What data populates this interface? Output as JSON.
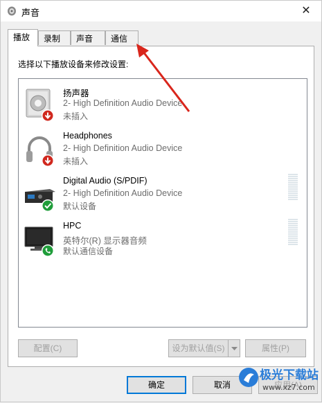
{
  "window": {
    "title": "声音",
    "close_glyph": "✕"
  },
  "tabs": [
    {
      "label": "播放",
      "active": true
    },
    {
      "label": "录制",
      "active": false
    },
    {
      "label": "声音",
      "active": false
    },
    {
      "label": "通信",
      "active": false
    }
  ],
  "instruction": "选择以下播放设备来修改设置:",
  "devices": [
    {
      "name": "扬声器",
      "line2": "2- High Definition Audio Device",
      "line3": "未插入",
      "icon": "speaker-icon",
      "status": "unplugged"
    },
    {
      "name": "Headphones",
      "line2": "2- High Definition Audio Device",
      "line3": "未插入",
      "icon": "headphones-icon",
      "status": "unplugged"
    },
    {
      "name": "Digital Audio (S/PDIF)",
      "line2": "2- High Definition Audio Device",
      "line3": "默认设备",
      "icon": "spdif-receiver-icon",
      "status": "default"
    },
    {
      "name": "HPC",
      "line2": "英特尔(R) 显示器音频",
      "line3": "默认通信设备",
      "icon": "monitor-icon",
      "status": "default-communication"
    }
  ],
  "buttons": {
    "configure": "配置(C)",
    "set_default": "设为默认值(S)",
    "properties": "属性(P)",
    "ok": "确定",
    "cancel": "取消",
    "apply": "应用(A)"
  },
  "watermark": {
    "text": "极光下载站",
    "url": "www.xz7.com"
  },
  "colors": {
    "accent": "#0078d7",
    "annotation_arrow": "#d9261c",
    "status_green": "#1f9d3a",
    "status_red": "#d0281e"
  }
}
